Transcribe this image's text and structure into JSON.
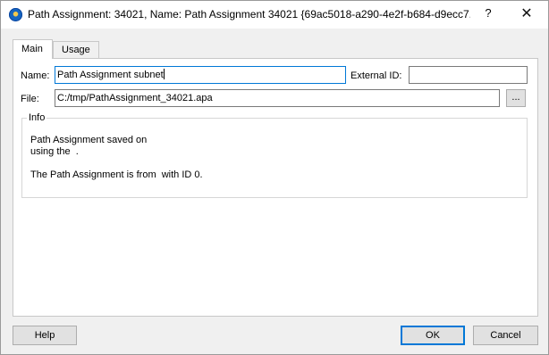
{
  "window": {
    "title": "Path Assignment: 34021, Name: Path Assignment 34021 {69ac5018-a290-4e2f-b684-d9ecc7...",
    "help_glyph": "?",
    "close_glyph": "✕"
  },
  "tabs": [
    {
      "label": "Main"
    },
    {
      "label": "Usage"
    }
  ],
  "form": {
    "name_label": "Name:",
    "name_value": "Path Assignment subnet",
    "external_id_label": "External ID:",
    "external_id_value": "",
    "file_label": "File:",
    "file_value": "C:/tmp/PathAssignment_34021.apa",
    "browse_label": "..."
  },
  "info": {
    "title": "Info",
    "line1": "Path Assignment saved on",
    "line2": "using the  .",
    "line3": "The Path Assignment is from  with ID 0."
  },
  "buttons": {
    "help": "Help",
    "ok": "OK",
    "cancel": "Cancel"
  },
  "colors": {
    "accent": "#0078d7",
    "window_bg": "#f0f0f0",
    "pane_bg": "#ffffff"
  }
}
